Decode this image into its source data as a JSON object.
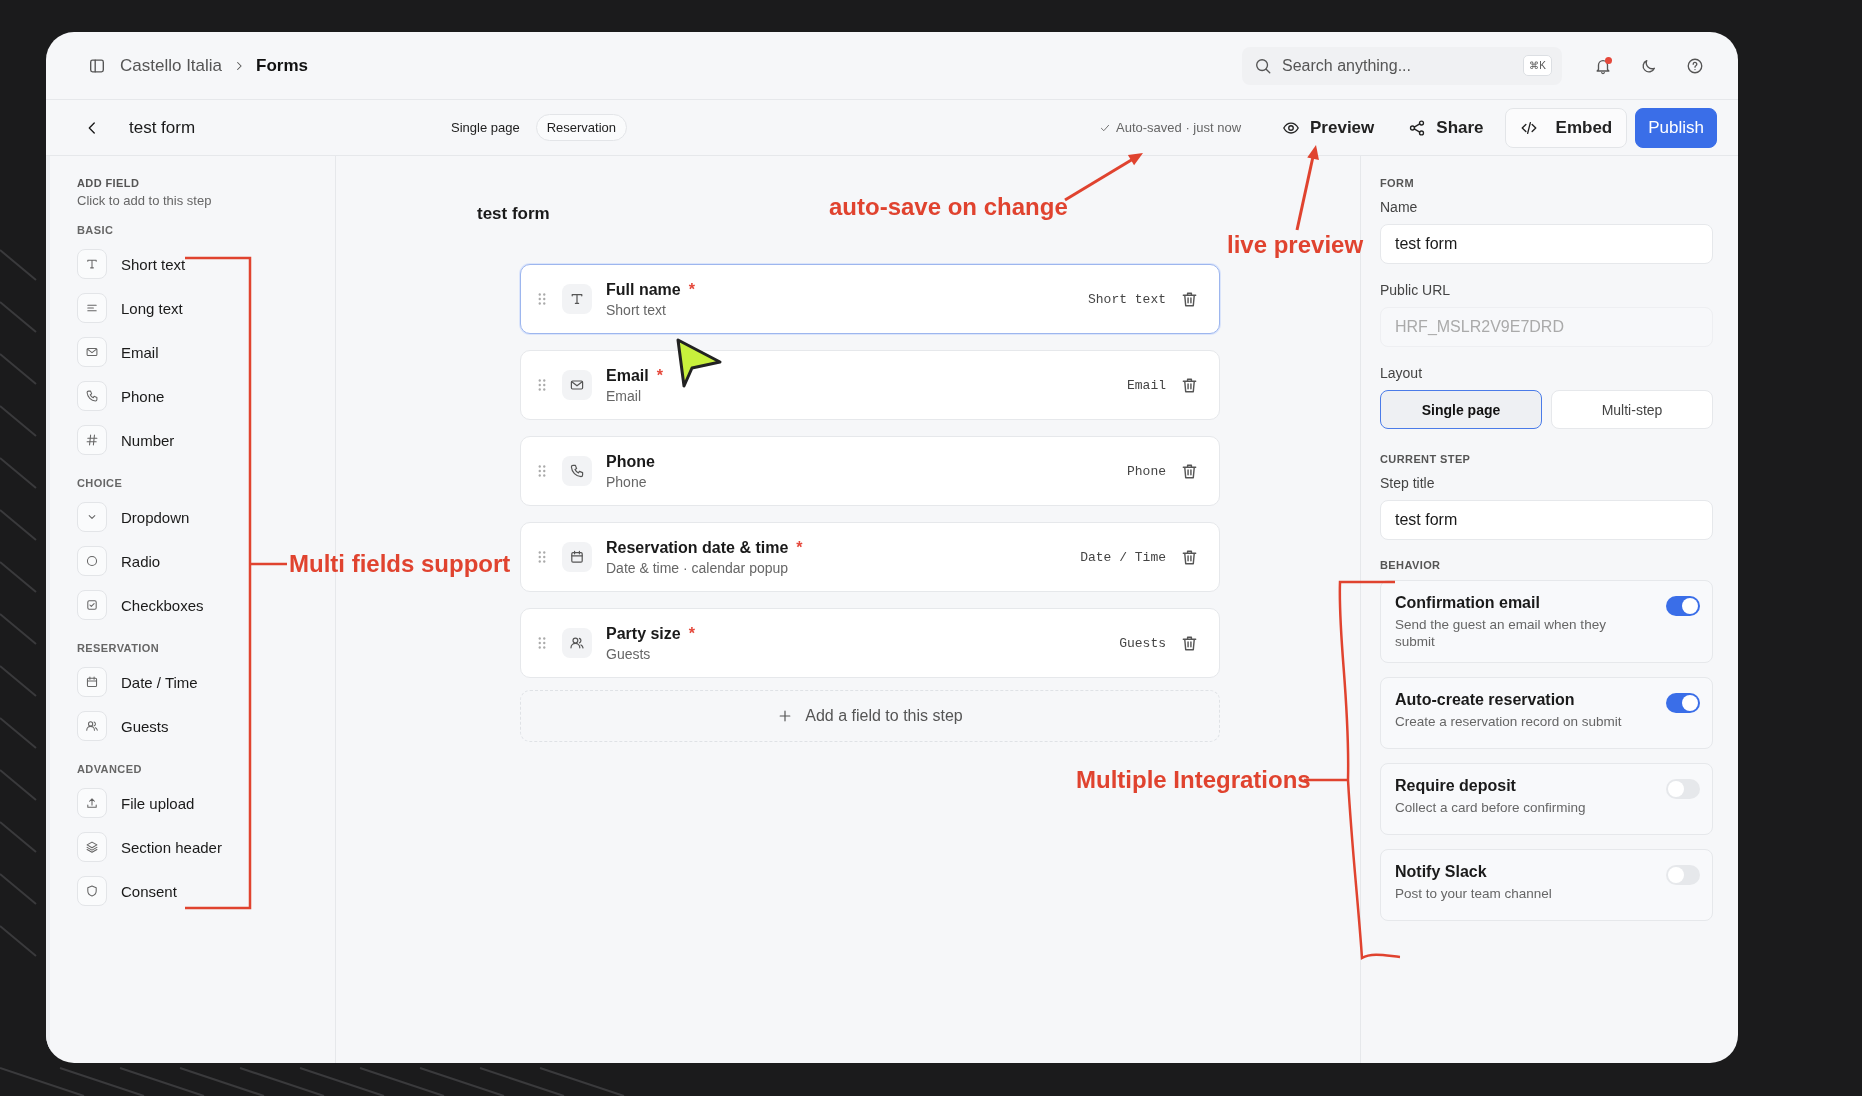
{
  "header": {
    "breadcrumb": [
      "Castello Italia",
      "Forms"
    ],
    "search": {
      "placeholder": "Search anything...",
      "shortcut": "⌘K"
    },
    "notification_dot": true
  },
  "toolbar": {
    "title": "test form",
    "tags": [
      {
        "label": "Single page",
        "kind": "plain"
      },
      {
        "label": "Reservation",
        "kind": "pill"
      }
    ],
    "status": "Auto-saved · just now",
    "actions": [
      {
        "label": "Preview",
        "kind": "eye"
      },
      {
        "label": "Share",
        "kind": "share"
      },
      {
        "label": "Embed",
        "kind": "code"
      },
      {
        "label": "Publish",
        "kind": "primary"
      }
    ]
  },
  "sidebar": {
    "heading": "ADD FIELD",
    "hint": "Click to add to this step",
    "groups": [
      {
        "title": "BASIC",
        "items": [
          {
            "label": "Short text",
            "kind": "text"
          },
          {
            "label": "Long text",
            "kind": "lines"
          },
          {
            "label": "Email",
            "kind": "mail"
          },
          {
            "label": "Phone",
            "kind": "phone"
          },
          {
            "label": "Number",
            "kind": "hash"
          }
        ]
      },
      {
        "title": "CHOICE",
        "items": [
          {
            "label": "Dropdown",
            "kind": "chevron"
          },
          {
            "label": "Radio",
            "kind": "circle"
          },
          {
            "label": "Checkboxes",
            "kind": "checkbox"
          }
        ]
      },
      {
        "title": "RESERVATION",
        "items": [
          {
            "label": "Date / Time",
            "kind": "calendar"
          },
          {
            "label": "Guests",
            "kind": "users"
          }
        ]
      },
      {
        "title": "ADVANCED",
        "items": [
          {
            "label": "File upload",
            "kind": "upload"
          },
          {
            "label": "Section header",
            "kind": "layers"
          },
          {
            "label": "Consent",
            "kind": "shield"
          }
        ]
      }
    ]
  },
  "canvas": {
    "title": "test form",
    "required_marker": "*",
    "fields": [
      {
        "label": "Full name",
        "required": true,
        "subtitle": "Short text",
        "type_label": "Short text",
        "kind": "text",
        "selected": true
      },
      {
        "label": "Email",
        "required": true,
        "subtitle": "Email",
        "type_label": "Email",
        "kind": "mail",
        "selected": false
      },
      {
        "label": "Phone",
        "required": false,
        "subtitle": "Phone",
        "type_label": "Phone",
        "kind": "phone",
        "selected": false
      },
      {
        "label": "Reservation date & time",
        "required": true,
        "subtitle": "Date & time · calendar popup",
        "type_label": "Date / Time",
        "kind": "calendar",
        "selected": false
      },
      {
        "label": "Party size",
        "required": true,
        "subtitle": "Guests",
        "type_label": "Guests",
        "kind": "users",
        "selected": false
      }
    ],
    "add_button": "Add a field to this step"
  },
  "settings": {
    "form_section": "FORM",
    "name": {
      "label": "Name",
      "value": "test form"
    },
    "public_url": {
      "label": "Public URL",
      "placeholder": "HRF_MSLR2V9E7DRD",
      "disabled": true
    },
    "layout": {
      "label": "Layout",
      "options": [
        {
          "label": "Single page",
          "selected": true
        },
        {
          "label": "Multi-step",
          "selected": false
        }
      ]
    },
    "step_section": "CURRENT STEP",
    "step_title": {
      "label": "Step title",
      "value": "test form"
    },
    "behavior_section": "BEHAVIOR",
    "behaviors": [
      {
        "title": "Confirmation email",
        "description": "Send the guest an email when they submit",
        "on": true
      },
      {
        "title": "Auto-create reservation",
        "description": "Create a reservation record on submit",
        "on": true
      },
      {
        "title": "Require deposit",
        "description": "Collect a card before confirming",
        "on": false
      },
      {
        "title": "Notify Slack",
        "description": "Post to your team channel",
        "on": false
      }
    ]
  },
  "annotations": [
    {
      "text": "auto-save on change",
      "kind": "arrow"
    },
    {
      "text": "live preview",
      "kind": "arrow"
    },
    {
      "text": "Multi fields support",
      "kind": "bracket"
    },
    {
      "text": "Multiple Integrations",
      "kind": "bracket"
    }
  ]
}
